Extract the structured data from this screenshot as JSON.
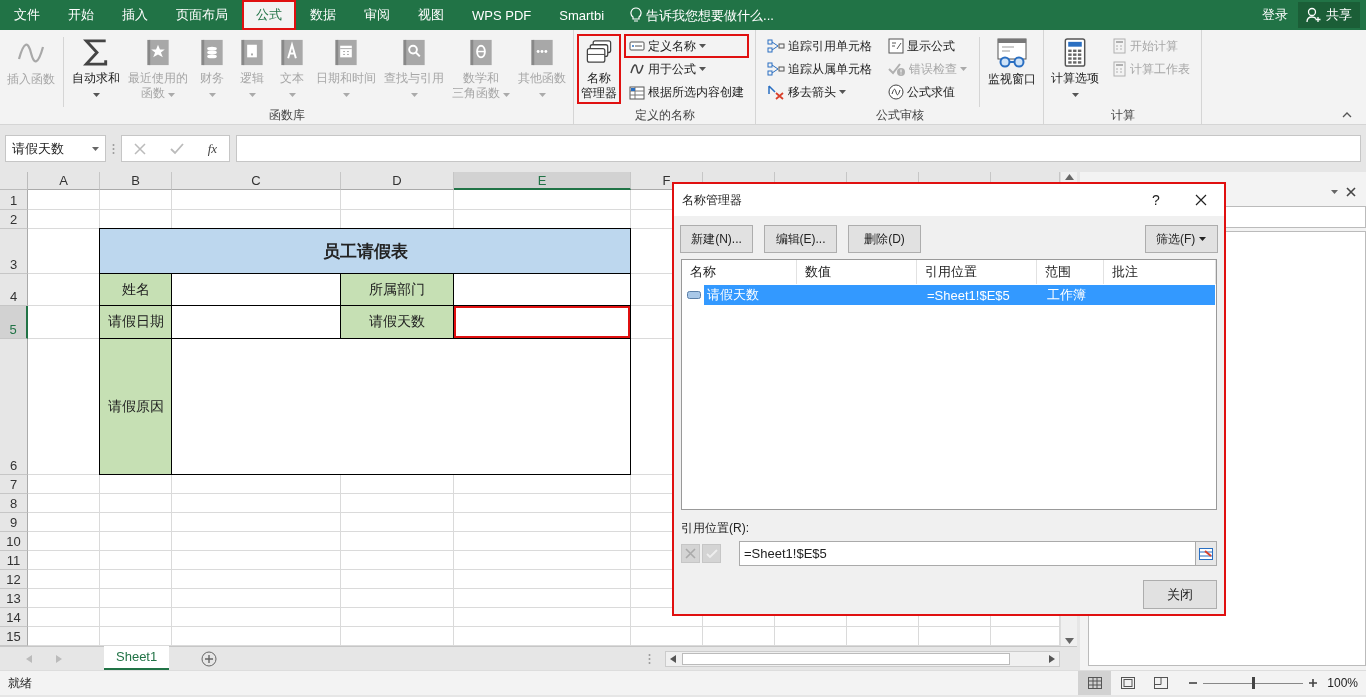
{
  "menu_tabs": [
    {
      "label": "文件",
      "selected": false,
      "highlighted": false
    },
    {
      "label": "开始",
      "selected": false,
      "highlighted": false
    },
    {
      "label": "插入",
      "selected": false,
      "highlighted": false
    },
    {
      "label": "页面布局",
      "selected": false,
      "highlighted": false
    },
    {
      "label": "公式",
      "selected": true,
      "highlighted": true
    },
    {
      "label": "数据",
      "selected": false,
      "highlighted": false
    },
    {
      "label": "审阅",
      "selected": false,
      "highlighted": false
    },
    {
      "label": "视图",
      "selected": false,
      "highlighted": false
    },
    {
      "label": "WPS PDF",
      "selected": false,
      "highlighted": false
    },
    {
      "label": "Smartbi",
      "selected": false,
      "highlighted": false
    }
  ],
  "tell_me": {
    "placeholder": "告诉我您想要做什么..."
  },
  "account": {
    "sign_in": "登录",
    "share": "共享"
  },
  "ribbon": {
    "groups": [
      {
        "title": "函数库",
        "columns": [
          {
            "kind": "large",
            "lines": [
              "插入函数"
            ],
            "disabled": true,
            "dropdown": false,
            "highlighted": false
          },
          {
            "kind": "separator"
          },
          {
            "kind": "large",
            "lines": [
              "自动求和"
            ],
            "disabled": false,
            "dropdown": true,
            "highlighted": false
          },
          {
            "kind": "large",
            "lines": [
              "最近使用的",
              "函数"
            ],
            "disabled": true,
            "dropdown": true,
            "highlighted": false
          },
          {
            "kind": "large",
            "lines": [
              "财务"
            ],
            "disabled": true,
            "dropdown": true,
            "highlighted": false
          },
          {
            "kind": "large",
            "lines": [
              "逻辑"
            ],
            "disabled": true,
            "dropdown": true,
            "highlighted": false
          },
          {
            "kind": "large",
            "lines": [
              "文本"
            ],
            "disabled": true,
            "dropdown": true,
            "highlighted": false
          },
          {
            "kind": "large",
            "lines": [
              "日期和时间"
            ],
            "disabled": true,
            "dropdown": true,
            "highlighted": false
          },
          {
            "kind": "large",
            "lines": [
              "查找与引用"
            ],
            "disabled": true,
            "dropdown": true,
            "highlighted": false
          },
          {
            "kind": "large",
            "lines": [
              "数学和",
              "三角函数"
            ],
            "disabled": true,
            "dropdown": true,
            "highlighted": false
          },
          {
            "kind": "large",
            "lines": [
              "其他函数"
            ],
            "disabled": true,
            "dropdown": true,
            "highlighted": false
          }
        ]
      },
      {
        "title": "定义的名称",
        "columns": [
          {
            "kind": "large",
            "lines": [
              "名称",
              "管理器"
            ],
            "disabled": false,
            "dropdown": false,
            "highlighted": true
          },
          {
            "kind": "stack",
            "items": [
              {
                "label": "定义名称",
                "disabled": false,
                "dropdown": true,
                "highlighted": true
              },
              {
                "label": "用于公式",
                "disabled": false,
                "dropdown": true,
                "highlighted": false
              },
              {
                "label": "根据所选内容创建",
                "disabled": false,
                "dropdown": false,
                "highlighted": false
              }
            ]
          }
        ]
      },
      {
        "title": "公式审核",
        "columns": [
          {
            "kind": "stack",
            "items": [
              {
                "label": "追踪引用单元格",
                "disabled": false,
                "dropdown": false,
                "highlighted": false
              },
              {
                "label": "追踪从属单元格",
                "disabled": false,
                "dropdown": false,
                "highlighted": false
              },
              {
                "label": "移去箭头",
                "disabled": false,
                "dropdown": true,
                "highlighted": false
              }
            ]
          },
          {
            "kind": "stack",
            "items": [
              {
                "label": "显示公式",
                "disabled": false,
                "dropdown": false,
                "highlighted": false
              },
              {
                "label": "错误检查",
                "disabled": true,
                "dropdown": true,
                "highlighted": false
              },
              {
                "label": "公式求值",
                "disabled": false,
                "dropdown": false,
                "highlighted": false
              }
            ]
          },
          {
            "kind": "separator"
          },
          {
            "kind": "large",
            "lines": [
              "监视窗口"
            ],
            "disabled": false,
            "dropdown": false,
            "highlighted": false
          }
        ]
      },
      {
        "title": "计算",
        "columns": [
          {
            "kind": "large",
            "lines": [
              "计算选项"
            ],
            "disabled": false,
            "dropdown": true,
            "highlighted": false
          },
          {
            "kind": "stack",
            "items": [
              {
                "label": "开始计算",
                "disabled": true,
                "dropdown": false,
                "highlighted": false
              },
              {
                "label": "计算工作表",
                "disabled": true,
                "dropdown": false,
                "highlighted": false
              }
            ]
          }
        ]
      }
    ]
  },
  "formula_bar": {
    "name_box": "请假天数",
    "fx": "fx"
  },
  "sheet": {
    "columns": [
      {
        "label": "A",
        "selected": false
      },
      {
        "label": "B",
        "selected": false
      },
      {
        "label": "C",
        "selected": false
      },
      {
        "label": "D",
        "selected": false
      },
      {
        "label": "E",
        "selected": true
      },
      {
        "label": "F",
        "selected": false
      }
    ],
    "rows": [
      {
        "label": "1",
        "selected": false
      },
      {
        "label": "2",
        "selected": false
      },
      {
        "label": "3",
        "selected": false
      },
      {
        "label": "4",
        "selected": false
      },
      {
        "label": "5",
        "selected": true
      },
      {
        "label": "6",
        "selected": false
      },
      {
        "label": "7",
        "selected": false
      },
      {
        "label": "8",
        "selected": false
      },
      {
        "label": "9",
        "selected": false
      },
      {
        "label": "10",
        "selected": false
      },
      {
        "label": "11",
        "selected": false
      },
      {
        "label": "12",
        "selected": false
      },
      {
        "label": "13",
        "selected": false
      },
      {
        "label": "14",
        "selected": false
      },
      {
        "label": "15",
        "selected": false
      }
    ],
    "form": {
      "title": "员工请假表",
      "fields": [
        {
          "label": "姓名",
          "selected": false
        },
        {
          "label": "所属部门",
          "selected": false
        },
        {
          "label": "请假日期",
          "selected": false
        },
        {
          "label": "请假天数",
          "selected": true
        },
        {
          "label": "请假原因",
          "selected": false
        }
      ]
    }
  },
  "sheet_tabs": [
    {
      "label": "Sheet1",
      "selected": true
    }
  ],
  "status_bar": {
    "text": "就绪",
    "views": [
      {
        "selected": true
      },
      {
        "selected": false
      },
      {
        "selected": false
      }
    ],
    "zoom": {
      "level": 0.5,
      "reading": "100%"
    }
  },
  "dialog": {
    "title": "名称管理器",
    "help": "?",
    "highlighted": true,
    "buttons": [
      "新建(N)...",
      "编辑(E)...",
      "删除(D)"
    ],
    "filter": "筛选(F)",
    "columns": [
      "名称",
      "数值",
      "引用位置",
      "范围",
      "批注"
    ],
    "rows": [
      {
        "name": "请假天数",
        "refers_to": "=Sheet1!$E$5",
        "scope": "工作簿",
        "selected": true
      }
    ],
    "refers_label": "引用位置(R):",
    "refers_field": {
      "value": "=Sheet1!$E$5"
    },
    "close": "关闭"
  }
}
